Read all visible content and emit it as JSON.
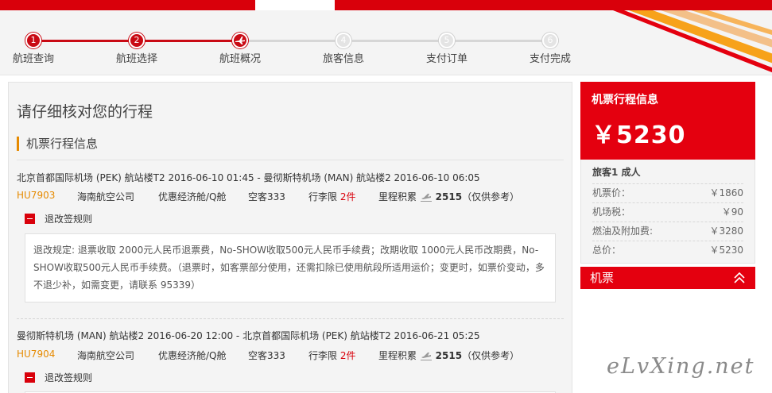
{
  "steps": [
    {
      "num": "1",
      "label": "航班查询",
      "state": "done"
    },
    {
      "num": "2",
      "label": "航班选择",
      "state": "done"
    },
    {
      "num": "",
      "label": "航班概况",
      "state": "current"
    },
    {
      "num": "4",
      "label": "旅客信息",
      "state": "todo"
    },
    {
      "num": "5",
      "label": "支付订单",
      "state": "todo"
    },
    {
      "num": "6",
      "label": "支付完成",
      "state": "todo"
    }
  ],
  "main": {
    "title": "请仔细核对您的行程",
    "section": "机票行程信息",
    "segments": [
      {
        "route": "北京首都国际机场 (PEK) 航站楼T2 2016-06-10 01:45 - 曼彻斯特机场 (MAN) 航站楼2 2016-06-10 06:05",
        "flight_no": "HU7903",
        "airline": "海南航空公司",
        "cabin": "优惠经济舱/Q舱",
        "aircraft": "空客333",
        "baggage_label": "行李限",
        "baggage": "2件",
        "miles_label": "里程积累",
        "miles": "2515",
        "miles_note": "（仅供参考）",
        "rules_label": "退改签规则",
        "rules_text": "退改规定: 退票收取 2000元人民币退票费，No-SHOW收取500元人民币手续费；改期收取 1000元人民币改期费，No-SHOW收取500元人民币手续费。（退票时，如客票部分使用，还需扣除已使用航段所适用运价；变更时，如票价变动，多不退少补，如需变更，请联系 95339）"
      },
      {
        "route": "曼彻斯特机场 (MAN) 航站楼2 2016-06-20 12:00 - 北京首都国际机场 (PEK) 航站楼T2 2016-06-21 05:25",
        "flight_no": "HU7904",
        "airline": "海南航空公司",
        "cabin": "优惠经济舱/Q舱",
        "aircraft": "空客333",
        "baggage_label": "行李限",
        "baggage": "2件",
        "miles_label": "里程积累",
        "miles": "2515",
        "miles_note": "（仅供参考）",
        "rules_label": "退改签规则"
      }
    ]
  },
  "side": {
    "title": "机票行程信息",
    "price": "￥5230",
    "passenger": "旅客1  成人",
    "fees": [
      {
        "label": "机票价：",
        "value": "￥1860"
      },
      {
        "label": "机场税：",
        "value": "￥90"
      },
      {
        "label": "燃油及附加费:",
        "value": "￥3280"
      },
      {
        "label": "总价：",
        "value": "￥5230"
      }
    ],
    "footer": "机票"
  },
  "watermark": "eLvXing.net",
  "colors": {
    "brand_red": "#e4000f",
    "flight_orange": "#e68a00"
  }
}
